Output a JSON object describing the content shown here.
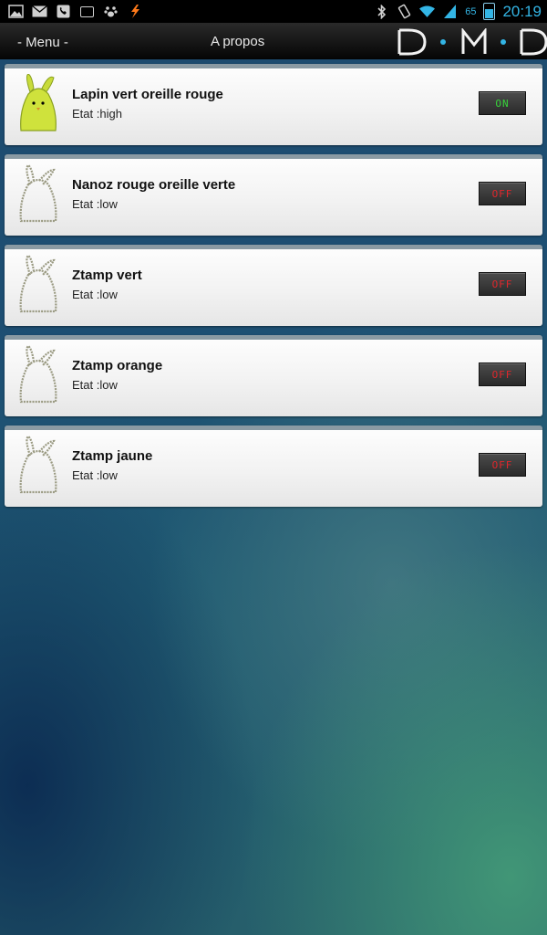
{
  "status_bar": {
    "left_icons": [
      "gallery-icon",
      "mail-icon",
      "phone-icon",
      "calendar-icon",
      "paw-icon",
      "flash-icon"
    ],
    "battery_level": "65",
    "clock": "20:19",
    "accent_color": "#33b5e5"
  },
  "action_bar": {
    "menu_label": "- Menu -",
    "title": "A propos",
    "logo_text": "D·M·D"
  },
  "devices": [
    {
      "name": "Lapin vert oreille rouge",
      "state": "Etat :high",
      "toggle": "ON",
      "active": true,
      "icon": "bunny-icon"
    },
    {
      "name": "Nanoz rouge oreille verte",
      "state": "Etat :low",
      "toggle": "OFF",
      "active": false,
      "icon": "bunny-outline-icon"
    },
    {
      "name": "Ztamp vert",
      "state": "Etat :low",
      "toggle": "OFF",
      "active": false,
      "icon": "bunny-outline-icon"
    },
    {
      "name": "Ztamp orange",
      "state": "Etat :low",
      "toggle": "OFF",
      "active": false,
      "icon": "bunny-outline-icon"
    },
    {
      "name": "Ztamp jaune",
      "state": "Etat :low",
      "toggle": "OFF",
      "active": false,
      "icon": "bunny-outline-icon"
    }
  ],
  "colors": {
    "on": "#37d43a",
    "off": "#e0262b"
  }
}
